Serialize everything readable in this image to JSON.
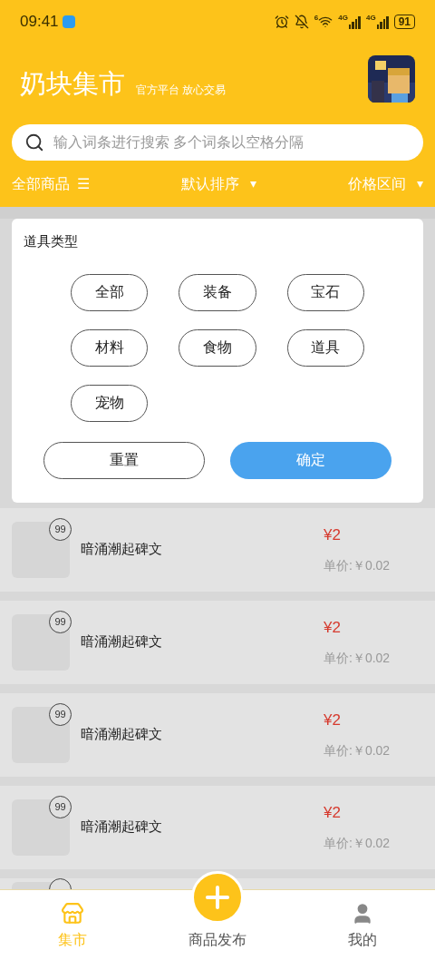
{
  "status_bar": {
    "time": "09:41",
    "network_1": "4G",
    "network_2": "4G",
    "battery": "91",
    "wifi_badge": "6"
  },
  "header": {
    "title": "奶块集市",
    "subtitle": "官方平台 放心交易"
  },
  "search": {
    "placeholder": "输入词条进行搜索 多个词条以空格分隔"
  },
  "filters": [
    {
      "label": "全部商品",
      "icon": "☰"
    },
    {
      "label": "默认排序",
      "icon": "▾"
    },
    {
      "label": "价格区间",
      "icon": "▾"
    }
  ],
  "filter_panel": {
    "title": "道具类型",
    "options": [
      {
        "label": "全部",
        "selected": false
      },
      {
        "label": "装备",
        "selected": false
      },
      {
        "label": "宝石",
        "selected": false
      },
      {
        "label": "材料",
        "selected": false
      },
      {
        "label": "食物",
        "selected": false
      },
      {
        "label": "道具",
        "selected": false
      },
      {
        "label": "宠物",
        "selected": false
      }
    ],
    "reset": "重置",
    "confirm": "确定"
  },
  "items": [
    {
      "kind": "full",
      "count": "99",
      "name": "暗涌潮起碑文",
      "price": "¥2",
      "unit_price": "单价:￥0.02"
    },
    {
      "kind": "full",
      "count": "99",
      "name": "暗涌潮起碑文",
      "price": "¥2",
      "unit_price": "单价:￥0.02"
    },
    {
      "kind": "full",
      "count": "99",
      "name": "暗涌潮起碑文",
      "price": "¥2",
      "unit_price": "单价:￥0.02"
    },
    {
      "kind": "full",
      "count": "99",
      "name": "暗涌潮起碑文",
      "price": "¥2",
      "unit_price": "单价:￥0.02"
    },
    {
      "kind": "partial"
    }
  ],
  "tabs": [
    {
      "label": "集市",
      "selected": true
    },
    {
      "label": "商品发布",
      "selected": false
    },
    {
      "label": "我的",
      "selected": false
    }
  ]
}
